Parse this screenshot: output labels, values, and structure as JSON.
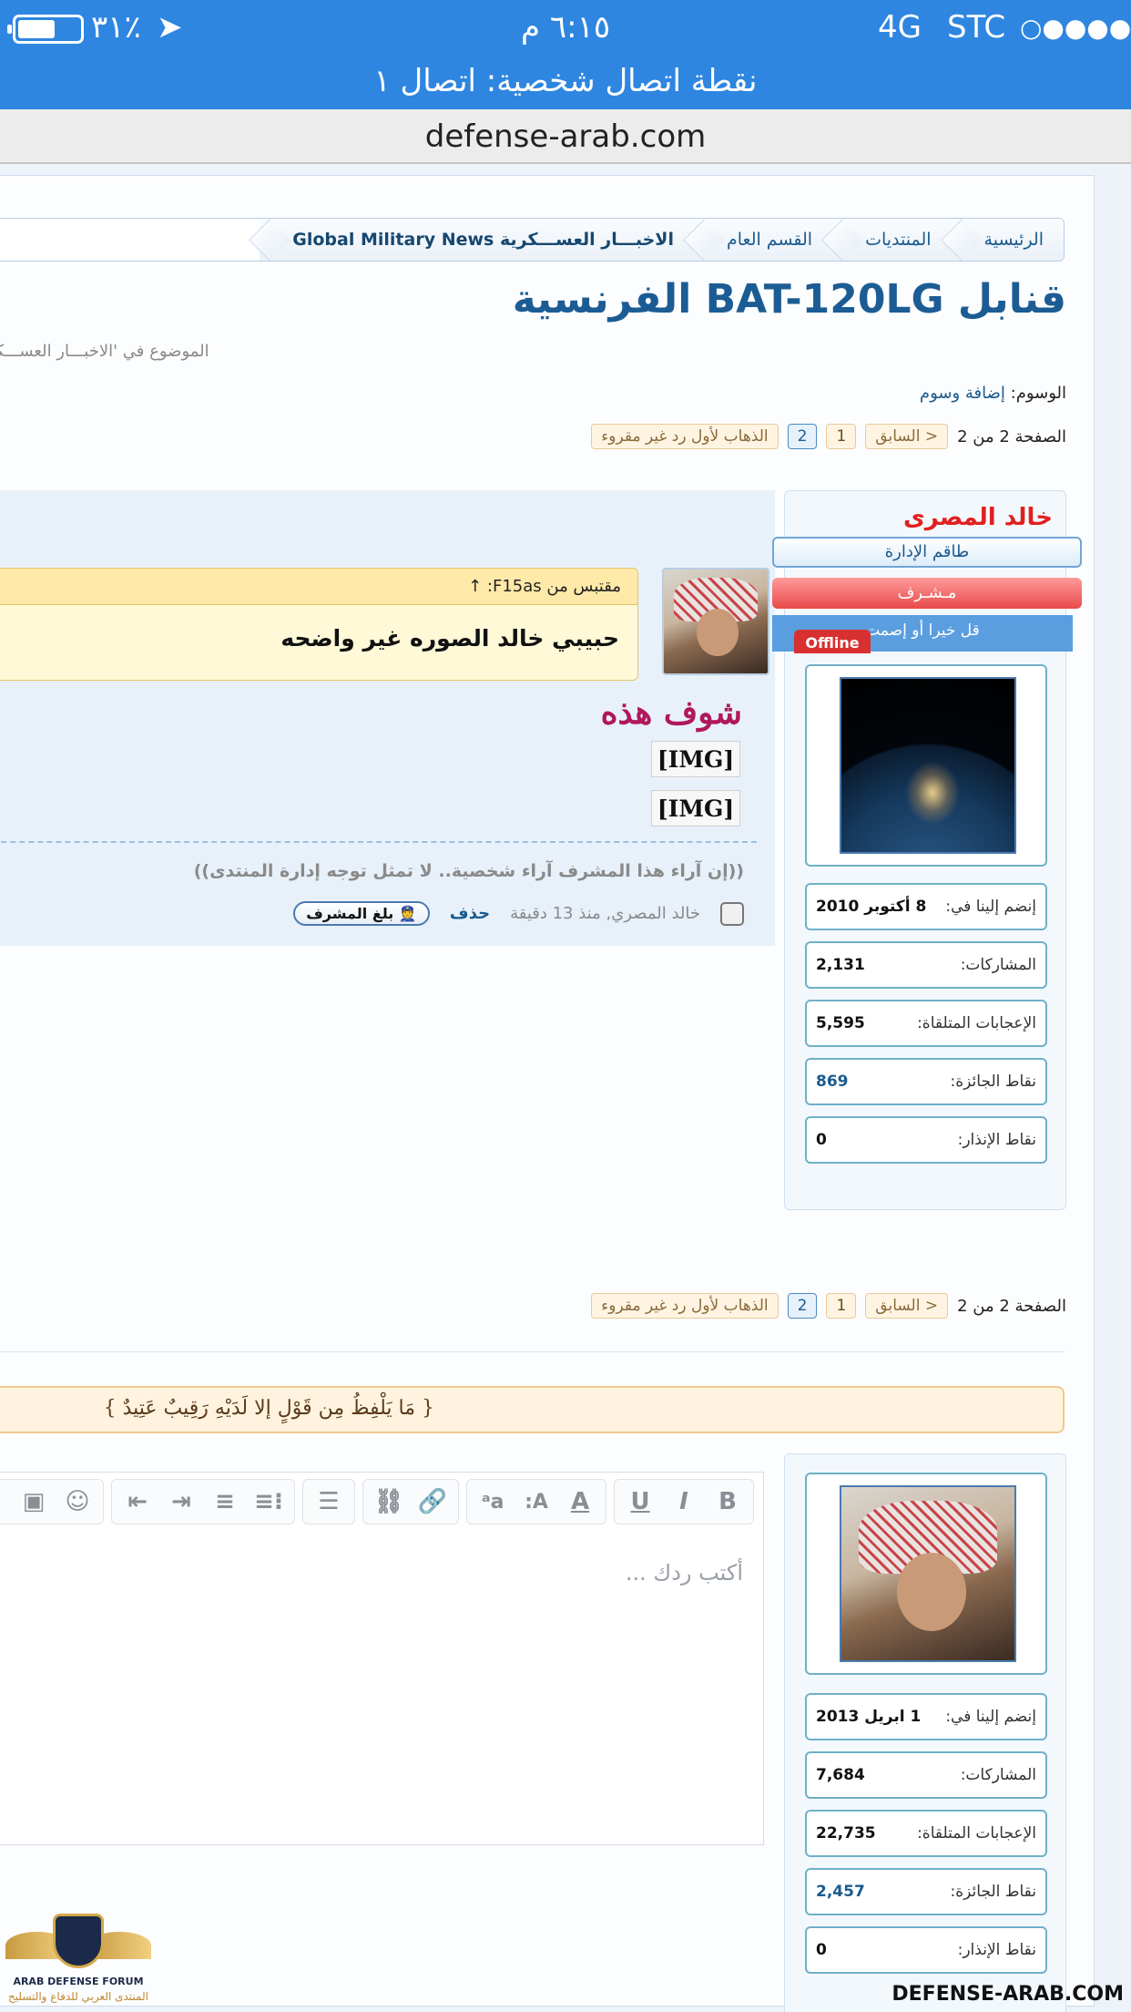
{
  "status_bar": {
    "carrier": "STC",
    "signal": "○●●●●",
    "network": "4G",
    "time": "٦:١٥ م",
    "battery_percent": "٣١٪"
  },
  "hotspot_banner": "نقطة اتصال شخصية: اتصال ١",
  "url": "defense-arab.com",
  "breadcrumb": [
    "الرئيسية",
    "المنتديات",
    "القسم العام",
    "الاخبـــار العســـكرية Global Military News"
  ],
  "thread": {
    "title": "قنابل BAT-120LG الفرنسية",
    "subtitle": "الموضوع في 'الاخبـــار العســـكرية",
    "tags_label": "الوسوم:",
    "tags_value": "إضافة وسوم"
  },
  "pagination": {
    "page_of": "الصفحة 2 من 2",
    "prev": "< السابق",
    "pages": [
      "1",
      "2"
    ],
    "current": "2",
    "first_unread": "الذهاب لأول رد غير مقروء"
  },
  "post": {
    "username": "خالد المصرى",
    "role": "طاقم الإدارة",
    "mod_label": "مـشـرف",
    "motto": "قل خيرا أو إصمت",
    "status": "Offline",
    "quote_header": "مقتبس من F15as: ↑",
    "quote_text": "حبيبي خالد الصوره غير واضحه",
    "message": "شوف هذه",
    "img_tags": [
      "[IMG]",
      "[IMG]"
    ],
    "signature": "((إن آراء هذا المشرف آراء شخصية.. لا تمثل توجه إدارة المنتدى))",
    "author_time": "خالد المصري, منذ 13 دقيقة",
    "delete": "حذف",
    "report": "بلغ المشرف"
  },
  "user_stats": [
    {
      "key": "إنضم إلينا في:",
      "value": "8 أكتوبر 2010"
    },
    {
      "key": "المشاركات:",
      "value": "2,131"
    },
    {
      "key": "الإعجابات المتلقاة:",
      "value": "5,595"
    },
    {
      "key": "نقاط الجائزة:",
      "value": "869"
    },
    {
      "key": "نقاط الإنذار:",
      "value": "0"
    }
  ],
  "verse": "{ مَا يَلْفِظُ مِن قَوْلٍ إلا لَدَيْهِ رَقِيبٌ عَتِيدٌ }",
  "editor": {
    "placeholder": "أكتب ردك ...",
    "tools": [
      "B",
      "I",
      "U",
      "A",
      "A:",
      "aa",
      "link",
      "unlink",
      "align",
      "list",
      "list2",
      "indent",
      "outdent",
      "smile",
      "image",
      "media"
    ]
  },
  "my_stats": [
    {
      "key": "إنضم إلينا في:",
      "value": "1 ابريل 2013"
    },
    {
      "key": "المشاركات:",
      "value": "7,684"
    },
    {
      "key": "الإعجابات المتلقاة:",
      "value": "22,735"
    },
    {
      "key": "نقاط الجائزة:",
      "value": "2,457"
    },
    {
      "key": "نقاط الإنذار:",
      "value": "0"
    }
  ],
  "logo": {
    "text_en": "ARAB DEFENSE FORUM",
    "text_ar": "المنتدى العربي للدفاع والتسليح"
  },
  "watermark": "DEFENSE-ARAB.COM",
  "colors": {
    "status_blue": "#2e86e0",
    "title_blue": "#1c5c94",
    "username_red": "#e02020",
    "message_magenta": "#b0185a"
  }
}
